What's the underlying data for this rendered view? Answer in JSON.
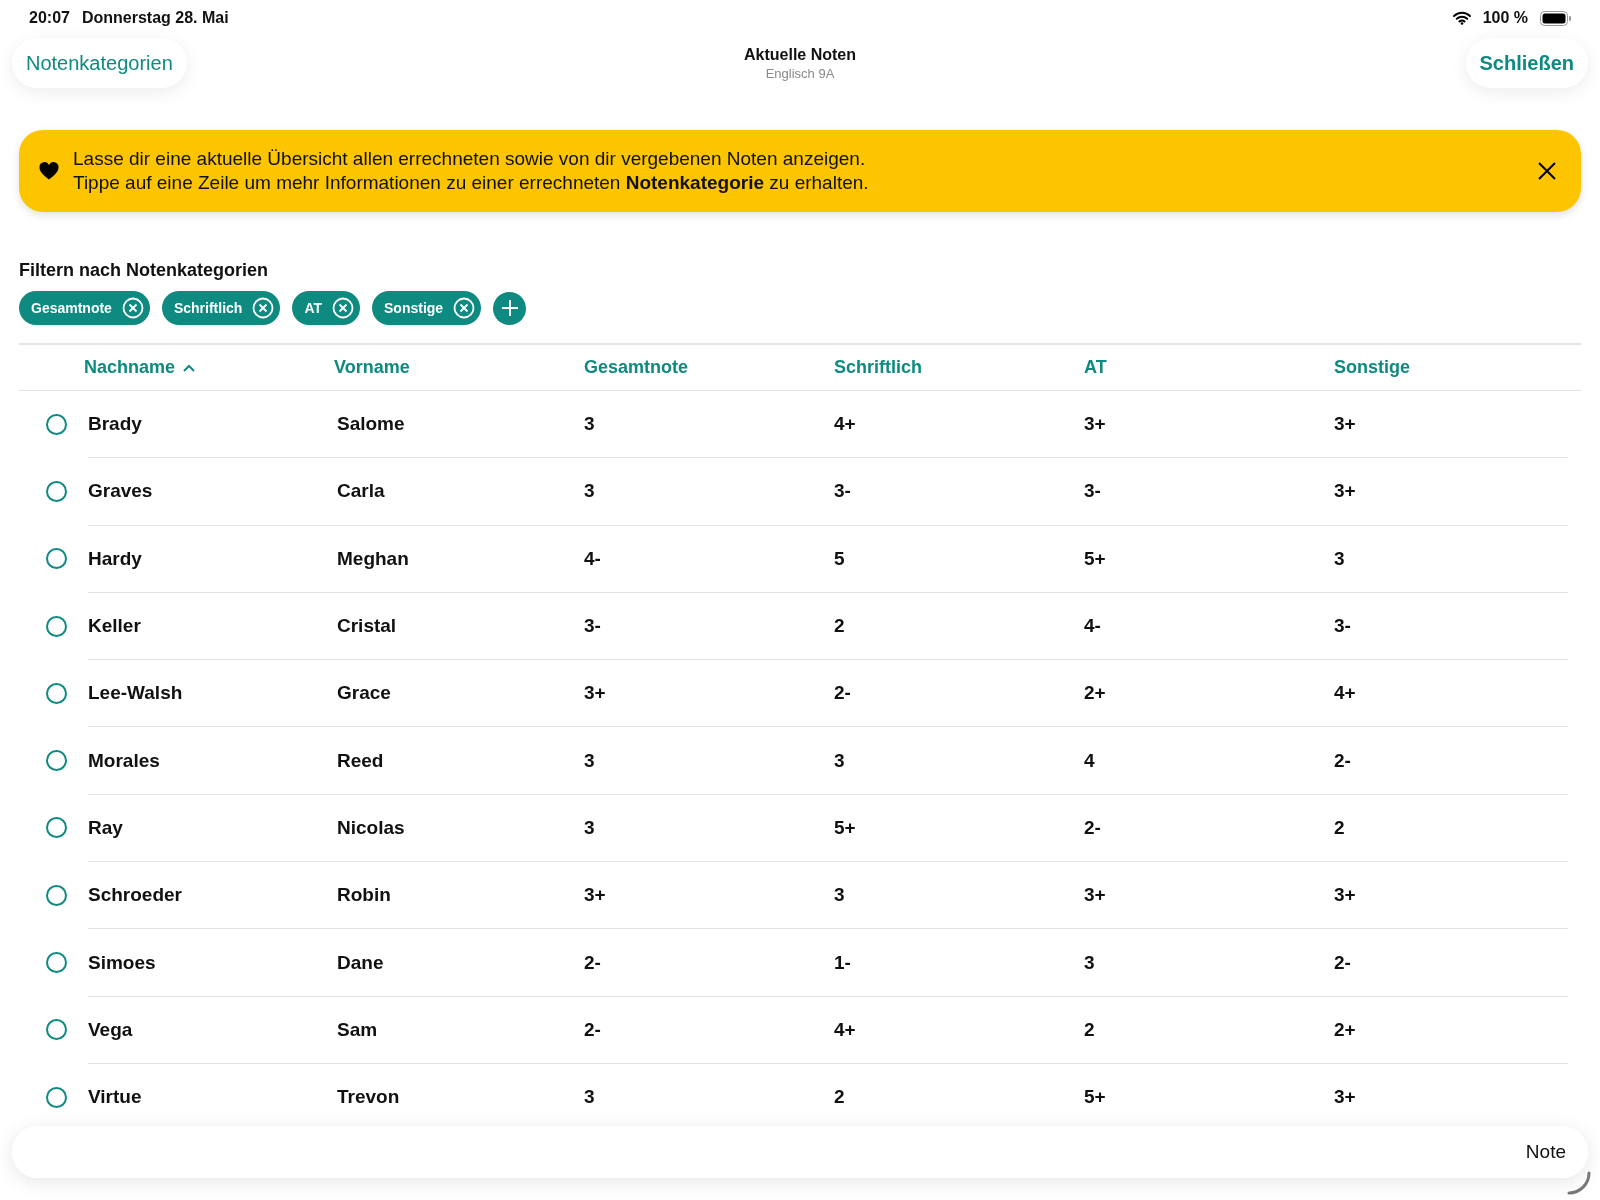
{
  "status_bar": {
    "time": "20:07",
    "date": "Donnerstag 28. Mai",
    "battery_text": "100 %"
  },
  "nav": {
    "left_button": "Notenkategorien",
    "title": "Aktuelle Noten",
    "subtitle": "Englisch 9A",
    "right_button": "Schließen"
  },
  "banner": {
    "lines": [
      "Lasse dir eine aktuelle Übersicht allen errechneten sowie von dir vergebenen Noten anzeigen.",
      "Tippe auf eine Zeile um mehr Informationen zu einer errechneten **Notenkategorie** zu erhalten."
    ]
  },
  "filter": {
    "title": "Filtern nach Notenkategorien",
    "chips": [
      "Gesamtnote",
      "Schriftlich",
      "AT",
      "Sonstige"
    ]
  },
  "table": {
    "columns": [
      {
        "label": "Nachname",
        "sorted": true
      },
      {
        "label": "Vorname",
        "sorted": false
      },
      {
        "label": "Gesamtnote",
        "sorted": false
      },
      {
        "label": "Schriftlich",
        "sorted": false
      },
      {
        "label": "AT",
        "sorted": false
      },
      {
        "label": "Sonstige",
        "sorted": false
      }
    ],
    "rows": [
      {
        "selected": false,
        "cells": [
          "Brady",
          "Salome",
          "3",
          "4+",
          "3+",
          "3+"
        ]
      },
      {
        "selected": false,
        "cells": [
          "Graves",
          "Carla",
          "3",
          "3-",
          "3-",
          "3+"
        ]
      },
      {
        "selected": false,
        "cells": [
          "Hardy",
          "Meghan",
          "4-",
          "5",
          "5+",
          "3"
        ]
      },
      {
        "selected": false,
        "cells": [
          "Keller",
          "Cristal",
          "3-",
          "2",
          "4-",
          "3-"
        ]
      },
      {
        "selected": false,
        "cells": [
          "Lee-Walsh",
          "Grace",
          "3+",
          "2-",
          "2+",
          "4+"
        ]
      },
      {
        "selected": false,
        "cells": [
          "Morales",
          "Reed",
          "3",
          "3",
          "4",
          "2-"
        ]
      },
      {
        "selected": false,
        "cells": [
          "Ray",
          "Nicolas",
          "3",
          "5+",
          "2-",
          "2"
        ]
      },
      {
        "selected": false,
        "cells": [
          "Schroeder",
          "Robin",
          "3+",
          "3",
          "3+",
          "3+"
        ]
      },
      {
        "selected": false,
        "cells": [
          "Simoes",
          "Dane",
          "2-",
          "1-",
          "3",
          "2-"
        ]
      },
      {
        "selected": false,
        "cells": [
          "Vega",
          "Sam",
          "2-",
          "4+",
          "2",
          "2+"
        ]
      },
      {
        "selected": false,
        "cells": [
          "Virtue",
          "Trevon",
          "3",
          "2",
          "5+",
          "3+"
        ]
      }
    ]
  },
  "bottom_bar": {
    "label": "Note"
  }
}
